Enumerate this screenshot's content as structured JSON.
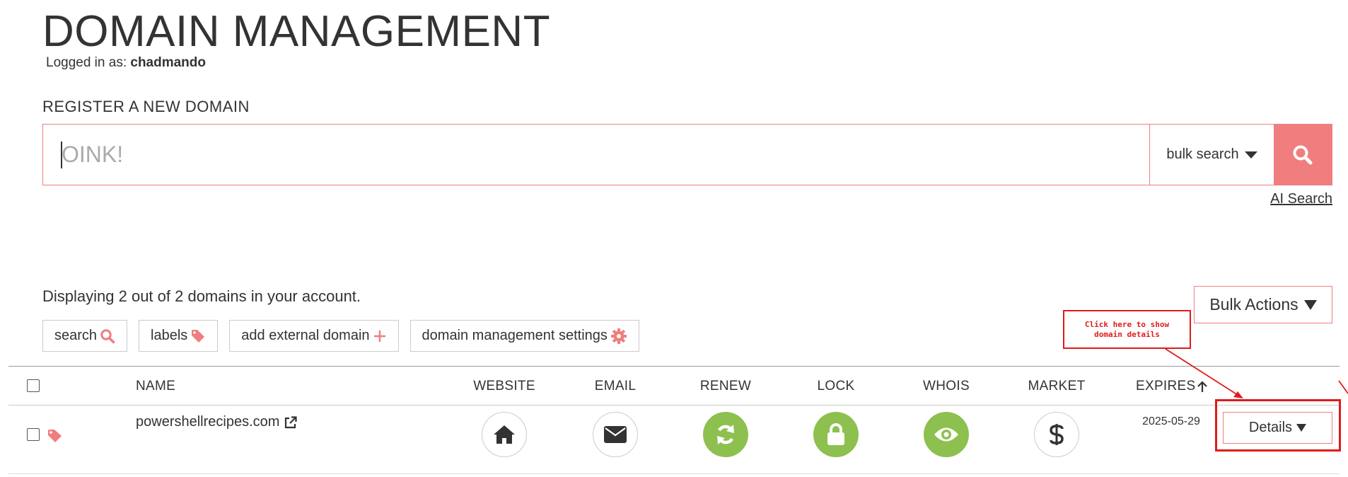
{
  "header": {
    "title": "DOMAIN MANAGEMENT",
    "logged_in_label": "Logged in as:",
    "username": "chadmando"
  },
  "register": {
    "heading": "REGISTER A NEW DOMAIN",
    "placeholder": "OINK!",
    "bulk_search_label": "bulk search",
    "ai_search_label": "AI Search"
  },
  "summary": {
    "displaying_text": "Displaying 2 out of 2 domains in your account.",
    "bulk_actions_label": "Bulk Actions"
  },
  "toolbar": {
    "search_label": "search",
    "labels_label": "labels",
    "add_external_label": "add external domain",
    "settings_label": "domain management settings"
  },
  "table": {
    "columns": {
      "name": "NAME",
      "website": "WEBSITE",
      "email": "EMAIL",
      "renew": "RENEW",
      "lock": "LOCK",
      "whois": "WHOIS",
      "market": "MARKET",
      "expires": "EXPIRES"
    },
    "rows": [
      {
        "name": "powershellrecipes.com",
        "expires": "2025-05-29",
        "details_label": "Details"
      }
    ]
  },
  "annotation": {
    "callout_text": "Click here to show domain details"
  },
  "colors": {
    "accent": "#f07e7e",
    "green": "#8dc04f",
    "annotation_red": "#e01b1b",
    "text": "#333333"
  },
  "icons": {
    "search_button": "search-icon",
    "website": "home-icon",
    "email": "envelope-icon",
    "renew": "refresh-icon",
    "lock": "lock-icon",
    "whois": "eye-icon",
    "market": "dollar-icon",
    "label_tag": "tag-icon",
    "external_link": "external-link-icon",
    "settings": "gear-icon",
    "add": "plus-icon",
    "sort": "arrow-up-icon"
  }
}
